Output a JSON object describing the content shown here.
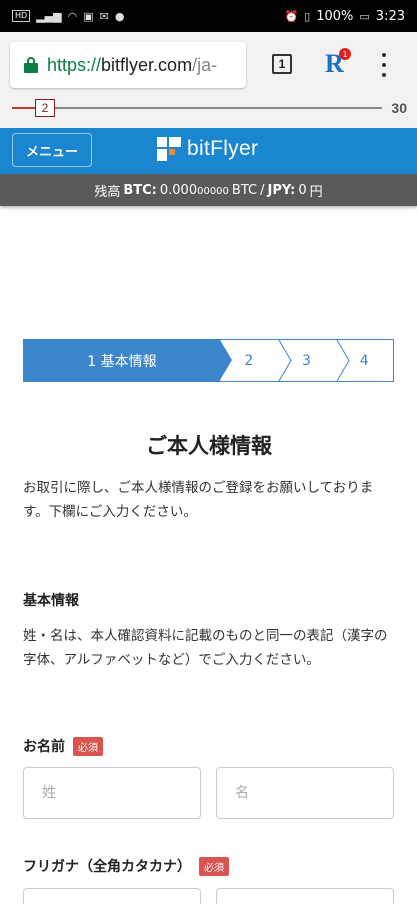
{
  "status_bar": {
    "network_badge": "HD",
    "signal_icon": "signal-icon",
    "battery": "100%",
    "time": "3:23"
  },
  "browser": {
    "url_scheme": "https://",
    "url_host": "bitflyer.com",
    "url_path": "/ja-",
    "tab_count": "1",
    "extension_letter": "R",
    "extension_badge": "1"
  },
  "slider": {
    "value": "2",
    "max": "30",
    "fraction": 0.034
  },
  "site": {
    "menu_label": "メニュー",
    "logo_text": "bitFlyer",
    "balance": {
      "prefix": "残高",
      "btc_label": "BTC:",
      "btc_value": "0.000",
      "btc_small": "00000",
      "btc_unit": "BTC",
      "sep": "/",
      "jpy_label": "JPY:",
      "jpy_value": "0",
      "jpy_unit": "円"
    }
  },
  "steps": [
    {
      "label": "1 基本情報",
      "active": true
    },
    {
      "label": "2"
    },
    {
      "label": "3"
    },
    {
      "label": "4"
    }
  ],
  "form": {
    "title": "ご本人様情報",
    "lead": "お取引に際し、ご本人様情報のご登録をお願いしております。下欄にご入力ください。",
    "section_title": "基本情報",
    "section_note": "姓・名は、本人確認資料に記載のものと同一の表記（漢字の字体、アルファベットなど）でご入力ください。",
    "name_label": "お名前",
    "kana_label": "フリガナ（全角カタカナ）",
    "required_badge": "必須",
    "last_name_placeholder": "姓",
    "first_name_placeholder": "名"
  },
  "colors": {
    "brand_blue": "#1b86d0",
    "step_blue": "#3b86cc",
    "required_red": "#d9534f",
    "secure_green": "#0b8043"
  }
}
